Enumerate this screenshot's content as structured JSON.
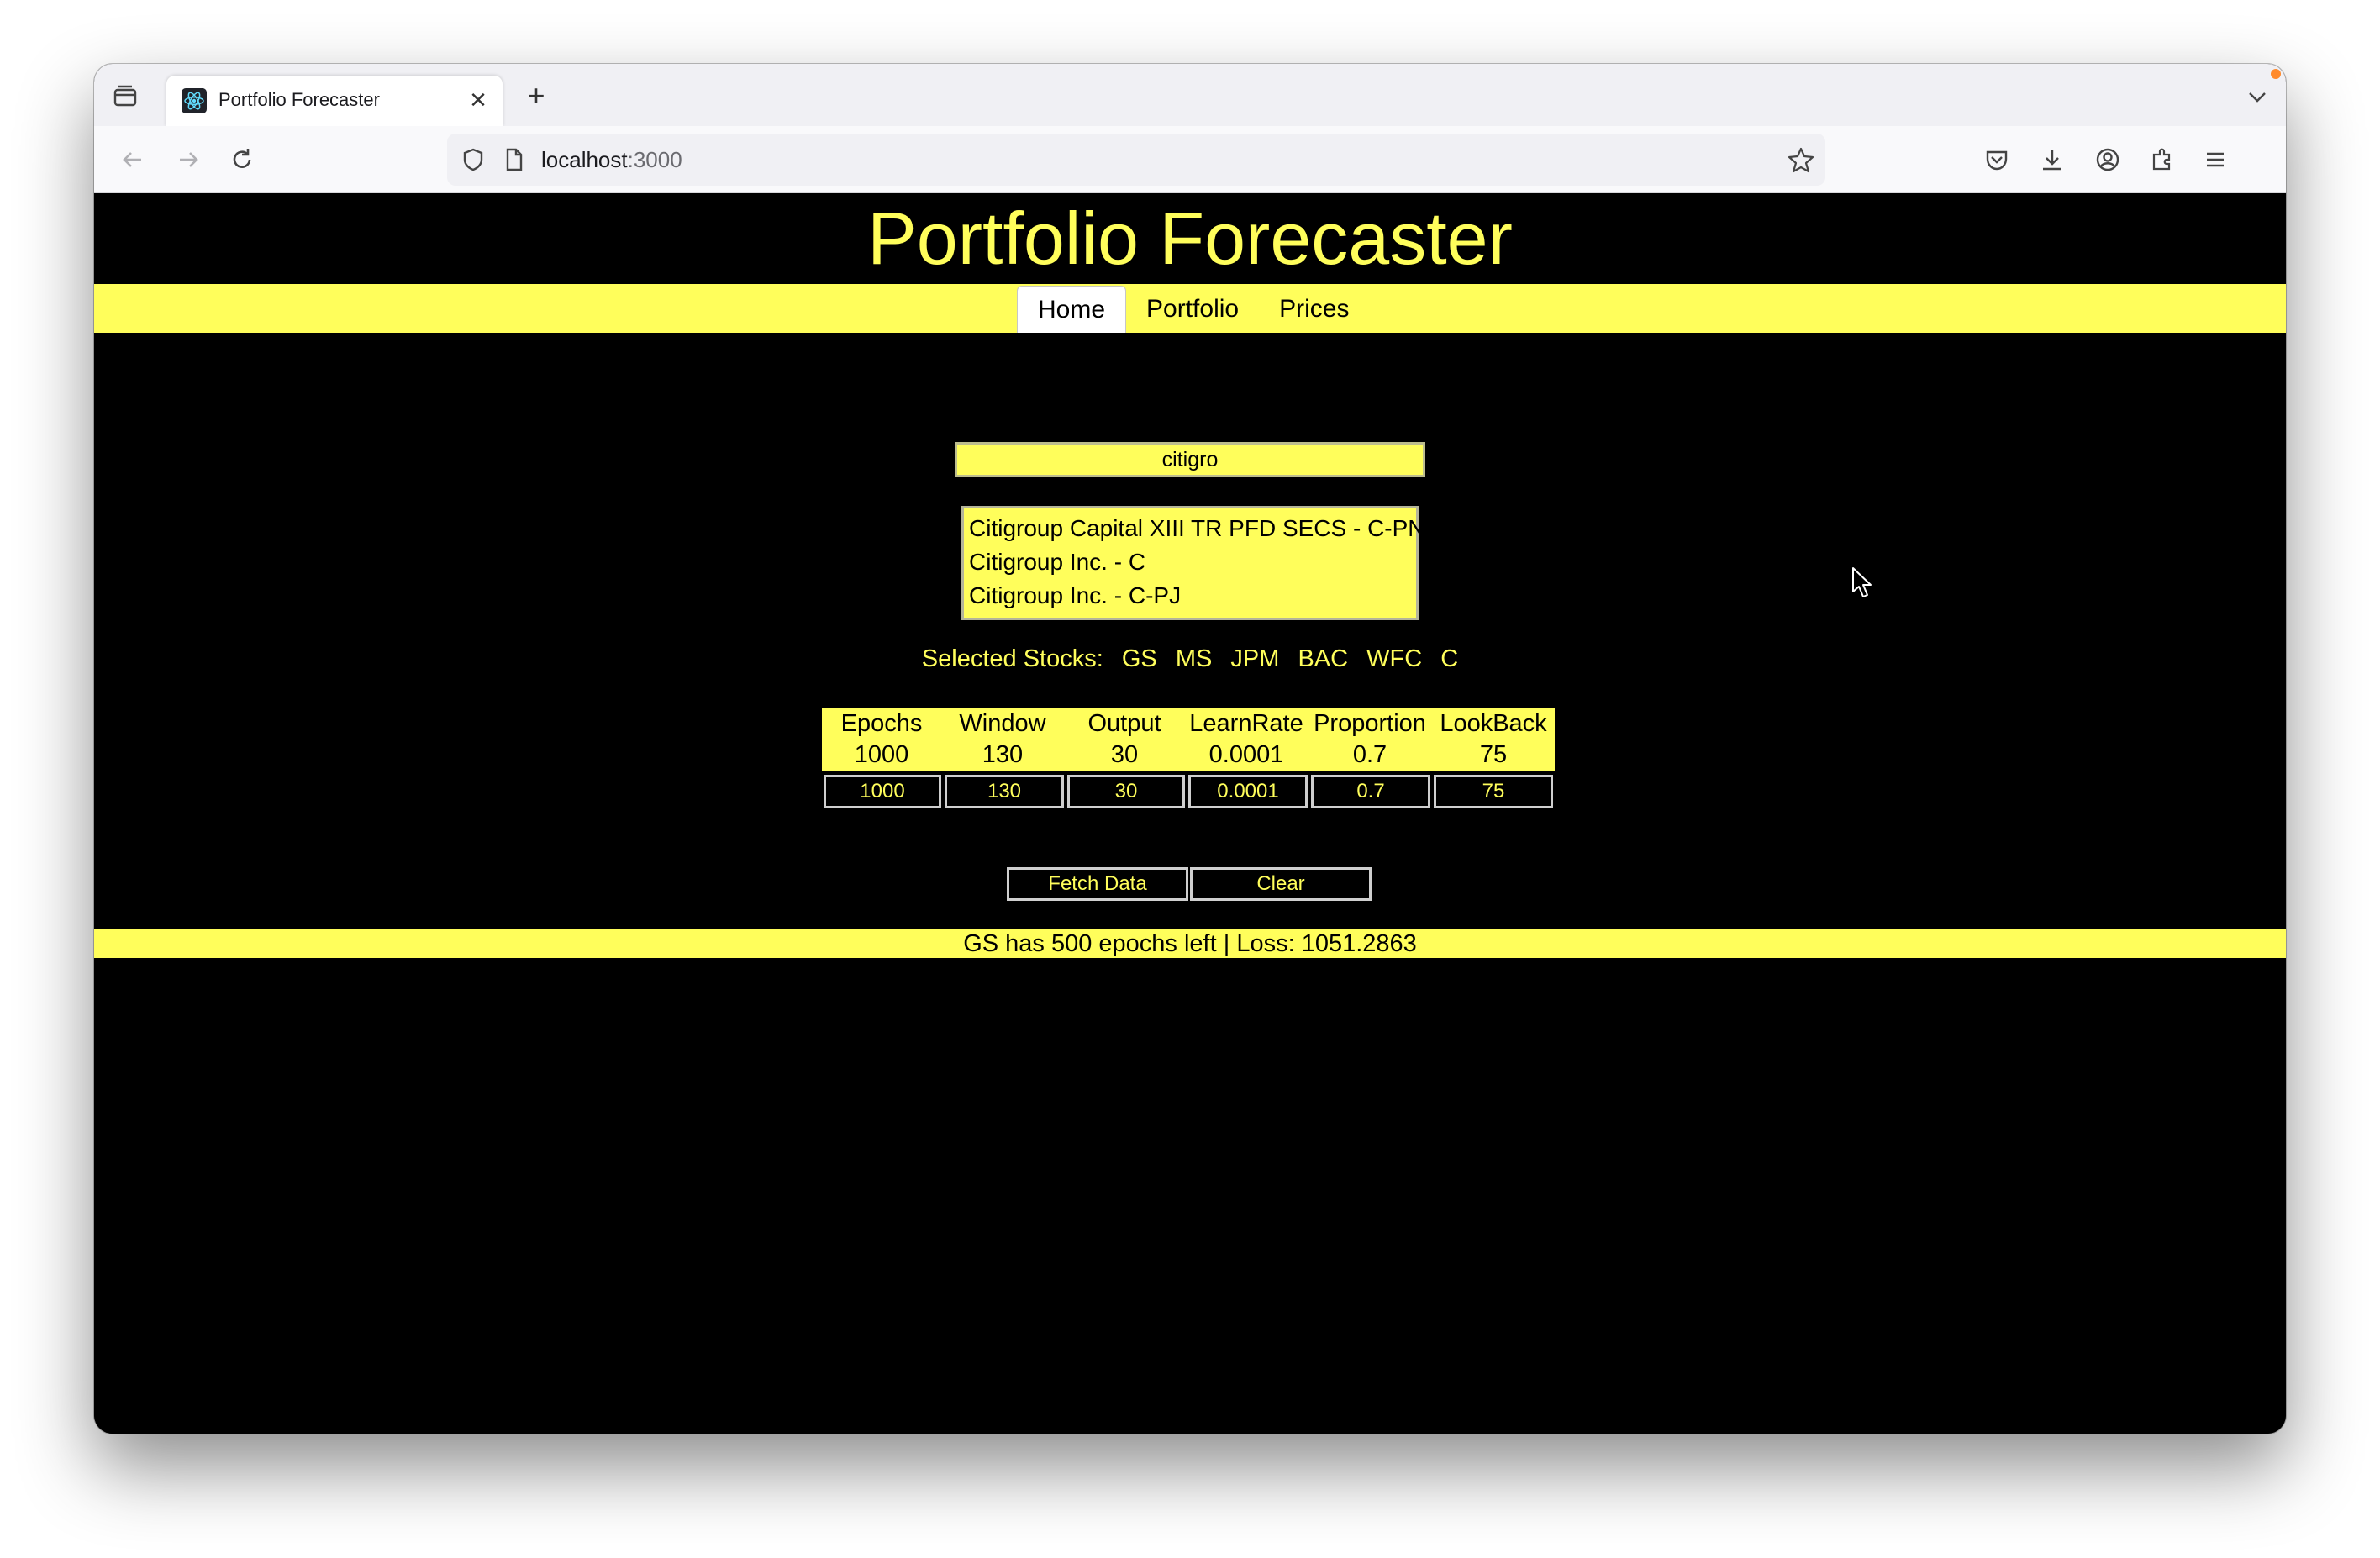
{
  "browser": {
    "tab_title": "Portfolio Forecaster",
    "url_host": "localhost",
    "url_port": ":3000"
  },
  "app": {
    "title": "Portfolio Forecaster",
    "menu": [
      "Home",
      "Portfolio",
      "Prices"
    ],
    "active_menu": "Home"
  },
  "search": {
    "value": "citigro",
    "results": [
      "Citigroup Capital XIII TR PFD SECS - C-PN",
      "Citigroup Inc. - C",
      "Citigroup Inc. - C-PJ"
    ]
  },
  "selected": {
    "label": "Selected Stocks:",
    "stocks": [
      "GS",
      "MS",
      "JPM",
      "BAC",
      "WFC",
      "C"
    ]
  },
  "params": [
    {
      "header": "Epochs",
      "value": "1000",
      "input": "1000"
    },
    {
      "header": "Window",
      "value": "130",
      "input": "130"
    },
    {
      "header": "Output",
      "value": "30",
      "input": "30"
    },
    {
      "header": "LearnRate",
      "value": "0.0001",
      "input": "0.0001"
    },
    {
      "header": "Proportion",
      "value": "0.7",
      "input": "0.7"
    },
    {
      "header": "LookBack",
      "value": "75",
      "input": "75"
    }
  ],
  "buttons": {
    "fetch": "Fetch Data",
    "clear": "Clear"
  },
  "status": "GS has 500 epochs left | Loss: 1051.2863",
  "colors": {
    "accent": "#fffe5b",
    "background": "#000000"
  }
}
